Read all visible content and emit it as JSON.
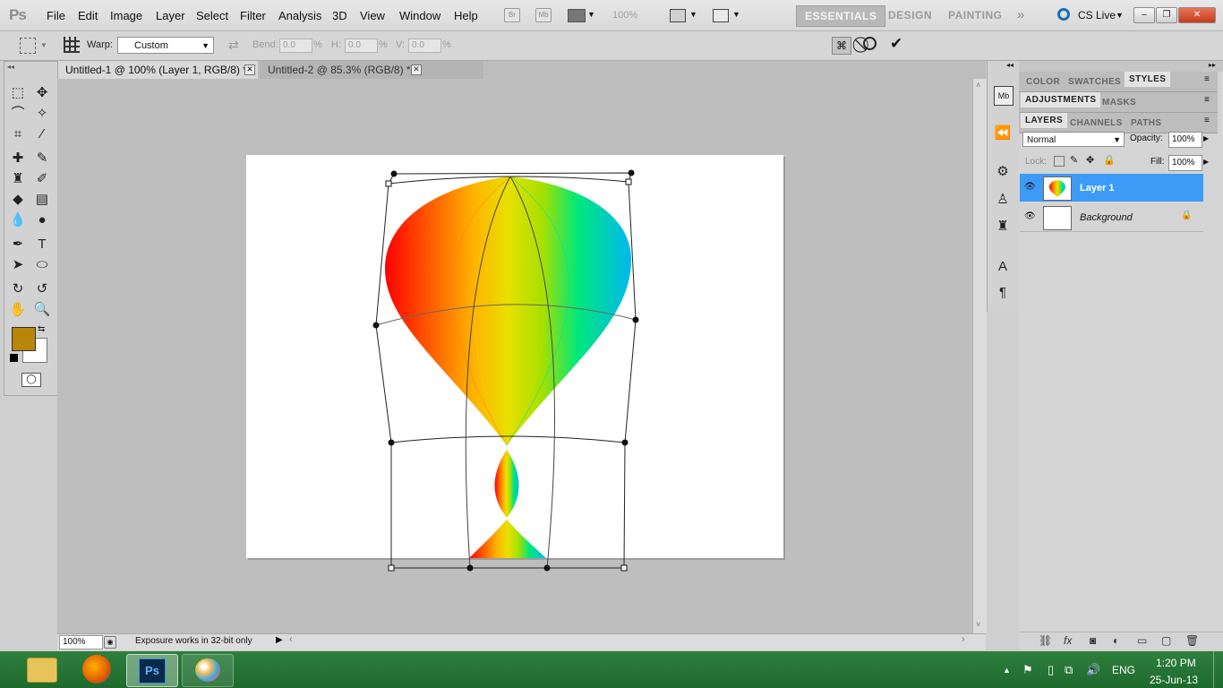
{
  "app": {
    "logo_text": "Ps"
  },
  "menu": [
    "File",
    "Edit",
    "Image",
    "Layer",
    "Select",
    "Filter",
    "Analysis",
    "3D",
    "View",
    "Window",
    "Help"
  ],
  "menubar_icons": {
    "bridge": "Br",
    "mini_bridge": "Mb",
    "zoom": "100%"
  },
  "workspaces": [
    "ESSENTIALS",
    "DESIGN",
    "PAINTING"
  ],
  "cslive": "CS Live",
  "options": {
    "warp_label": "Warp:",
    "warp_value": "Custom",
    "bend_label": "Bend:",
    "bend_value": "0.0",
    "h_label": "H:",
    "h_value": "0.0",
    "v_label": "V:",
    "v_value": "0.0",
    "pct": "%"
  },
  "doc_tabs": [
    {
      "label": "Untitled-1 @ 100% (Layer 1, RGB/8) *"
    },
    {
      "label": "Untitled-2 @ 85.3% (RGB/8) *"
    }
  ],
  "status": {
    "zoom": "100%",
    "text": "Exposure works in 32-bit only"
  },
  "panels": {
    "row1": [
      "COLOR",
      "SWATCHES",
      "STYLES"
    ],
    "row2": [
      "ADJUSTMENTS",
      "MASKS"
    ],
    "row3": [
      "LAYERS",
      "CHANNELS",
      "PATHS"
    ],
    "blend_mode": "Normal",
    "opacity_label": "Opacity:",
    "opacity_value": "100%",
    "lock_label": "Lock:",
    "fill_label": "Fill:",
    "fill_value": "100%"
  },
  "layers": [
    {
      "name": "Layer 1",
      "selected": true
    },
    {
      "name": "Background",
      "selected": false
    }
  ],
  "colors": {
    "foreground": "#b8860b",
    "background": "#ffffff",
    "accent": "#3d9bf7"
  },
  "taskbar": {
    "lang": "ENG",
    "time": "1:20 PM",
    "date": "25-Jun-13"
  }
}
